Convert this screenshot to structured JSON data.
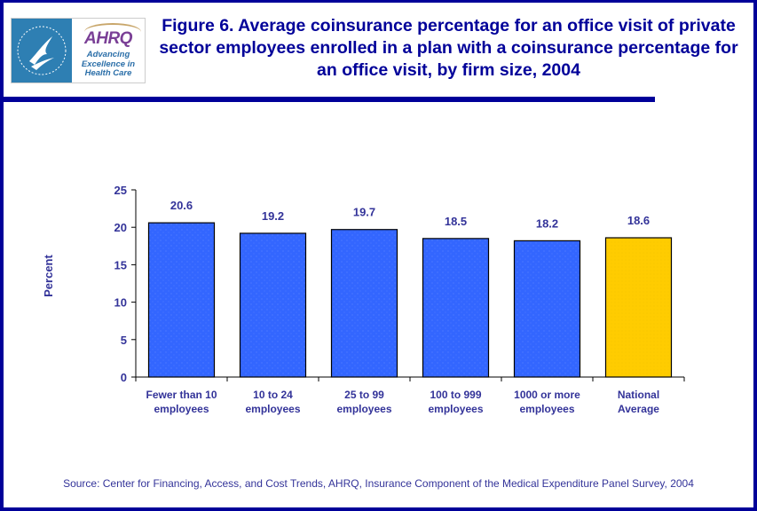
{
  "logo": {
    "agency_seal": "hhs-eagle-seal",
    "brand": "AHRQ",
    "tagline_lines": [
      "Advancing",
      "Excellence in",
      "Health Care"
    ]
  },
  "source": "Source: Center for Financing, Access, and Cost Trends, AHRQ, Insurance Component of the Medical Expenditure Panel Survey, 2004",
  "colors": {
    "frame": "#000099",
    "text": "#333399",
    "bar_primary": "#3366ff",
    "bar_highlight": "#ffcc00"
  },
  "chart_data": {
    "type": "bar",
    "title": "Figure 6. Average coinsurance percentage for an office visit of private sector employees enrolled in a plan with a coinsurance percentage for an office visit, by firm size, 2004",
    "xlabel": "",
    "ylabel": "Percent",
    "ylim": [
      0,
      25
    ],
    "yticks": [
      0,
      5,
      10,
      15,
      20,
      25
    ],
    "grid": false,
    "legend": "none",
    "categories": [
      [
        "Fewer than 10",
        "employees"
      ],
      [
        "10 to 24",
        "employees"
      ],
      [
        "25 to 99",
        "employees"
      ],
      [
        "100 to 999",
        "employees"
      ],
      [
        "1000 or more",
        "employees"
      ],
      [
        "National",
        "Average"
      ]
    ],
    "values": [
      20.6,
      19.2,
      19.7,
      18.5,
      18.2,
      18.6
    ],
    "value_labels": [
      "20.6",
      "19.2",
      "19.7",
      "18.5",
      "18.2",
      "18.6"
    ],
    "highlight_index": 5
  }
}
